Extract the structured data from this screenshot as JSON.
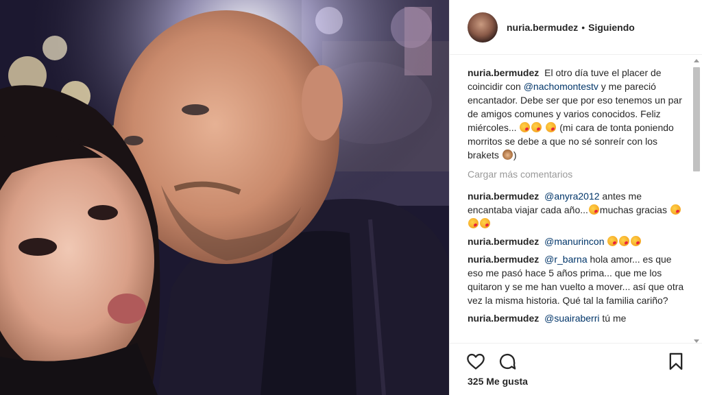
{
  "post": {
    "username": "nuria.bermudez",
    "separator": "•",
    "follow_status": "Siguiendo",
    "caption": {
      "username": "nuria.bermudez",
      "text_1": "El otro día tuve el placer de coincidir con",
      "mention": "@nachomontestv",
      "text_2": "y me pareció encantador. Debe ser que por eso tenemos un par de amigos comunes y varios conocidos. Feliz miércoles...",
      "text_3": "(mi cara de tonta poniendo morritos se debe a que no sé sonreír con los brakets",
      "text_4": ")"
    },
    "load_more": "Cargar más comentarios",
    "comments": [
      {
        "username": "nuria.bermudez",
        "mention": "@anyra2012",
        "text": "antes me encantaba viajar cada año...",
        "text_after": "muchas gracias"
      },
      {
        "username": "nuria.bermudez",
        "mention": "@manurincon",
        "text": ""
      },
      {
        "username": "nuria.bermudez",
        "mention": "@r_barna",
        "text": "hola amor... es que eso me pasó hace 5 años prima... que me los quitaron y se me han vuelto a mover... así que otra vez la misma historia. Qué tal la familia cariño?"
      },
      {
        "username": "nuria.bermudez",
        "mention": "@suairaberri",
        "text": "tú me"
      }
    ],
    "likes": "325 Me gusta"
  },
  "icons": {
    "like": "heart-icon",
    "comment": "comment-icon",
    "save": "bookmark-icon"
  },
  "colors": {
    "mention": "#003569",
    "muted": "#999999",
    "text": "#262626"
  }
}
